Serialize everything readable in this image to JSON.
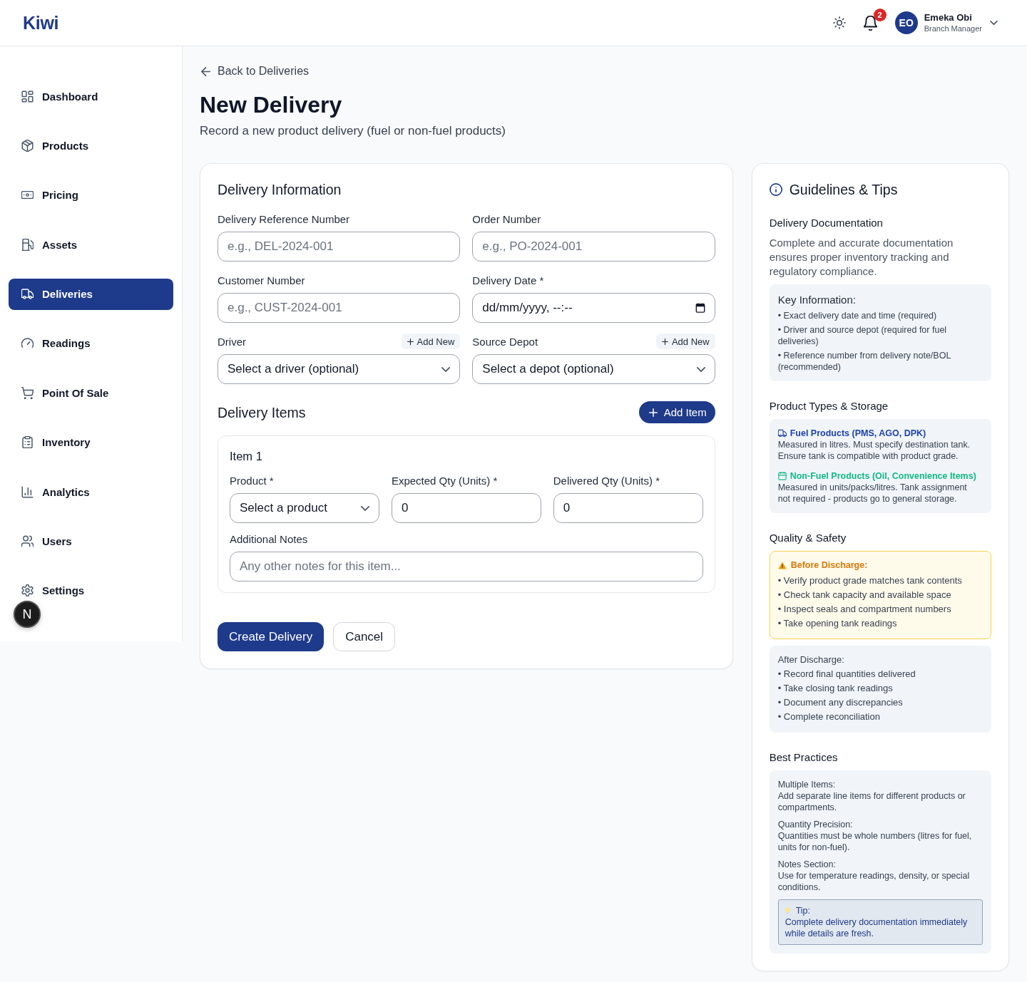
{
  "header": {
    "logo": "Kiwi",
    "notifications": "2",
    "user": {
      "initials": "EO",
      "name": "Emeka Obi",
      "role": "Branch Manager"
    }
  },
  "sidebar": {
    "items": [
      {
        "label": "Dashboard",
        "selected": false
      },
      {
        "label": "Products",
        "selected": false
      },
      {
        "label": "Pricing",
        "selected": false
      },
      {
        "label": "Assets",
        "selected": false
      },
      {
        "label": "Deliveries",
        "selected": true
      },
      {
        "label": "Readings",
        "selected": false
      },
      {
        "label": "Point Of Sale",
        "selected": false
      },
      {
        "label": "Inventory",
        "selected": false
      },
      {
        "label": "Analytics",
        "selected": false
      },
      {
        "label": "Users",
        "selected": false
      },
      {
        "label": "Settings",
        "selected": false
      }
    ]
  },
  "dev_indicator": {
    "label": "N"
  },
  "page": {
    "back_link": "Back to Deliveries",
    "title": "New Delivery",
    "subtitle": "Record a new product delivery (fuel or non-fuel products)"
  },
  "form": {
    "title": "Delivery Information",
    "fields": [
      {
        "kind": "text",
        "label": "Delivery Reference Number",
        "placeholder": "e.g., DEL-2024-001"
      },
      {
        "kind": "text",
        "label": "Order Number",
        "placeholder": "e.g., PO-2024-001"
      },
      {
        "kind": "text",
        "label": "Customer Number",
        "placeholder": "e.g., CUST-2024-001"
      },
      {
        "kind": "datetime",
        "label": "Delivery Date *",
        "value": "dd/mm/yyyy, --:--"
      },
      {
        "kind": "select",
        "label": "Driver",
        "value": "Select a driver (optional)",
        "action": "Add New"
      },
      {
        "kind": "select",
        "label": "Source Depot",
        "value": "Select a depot (optional)",
        "action": "Add New"
      }
    ],
    "items_section": {
      "title": "Delivery Items",
      "add_button": "Add Item",
      "items": [
        {
          "title": "Item 1",
          "fields": [
            {
              "kind": "select",
              "label": "Product *",
              "value": "Select a product"
            },
            {
              "kind": "number",
              "label": "Expected Qty (Units) *",
              "value": "0"
            },
            {
              "kind": "number",
              "label": "Delivered Qty (Units) *",
              "value": "0"
            }
          ],
          "notes": {
            "label": "Additional Notes",
            "placeholder": "Any other notes for this item..."
          }
        }
      ]
    },
    "actions": [
      {
        "kind": "primary",
        "label": "Create Delivery"
      },
      {
        "kind": "secondary",
        "label": "Cancel"
      }
    ]
  },
  "guidelines": {
    "title": "Guidelines & Tips",
    "sections": [
      {
        "heading": "Delivery Documentation",
        "text": "Complete and accurate documentation ensures proper inventory tracking and regulatory compliance.",
        "boxes": [
          {
            "kind": "info",
            "title": "Key Information:",
            "bullets": [
              "• Exact delivery date and time (required)",
              "• Driver and source depot (required for fuel deliveries)",
              "• Reference number from delivery note/BOL (recommended)"
            ]
          }
        ]
      },
      {
        "heading": "Product Types & Storage",
        "boxes": [
          {
            "kind": "types",
            "entries": [
              {
                "title": "Fuel Products (PMS, AGO, DPK)",
                "text": "Measured in litres. Must specify destination tank. Ensure tank is compatible with product grade.",
                "color": "#1e40af"
              },
              {
                "title": "Non-Fuel Products (Oil, Convenience Items)",
                "text": "Measured in units/packs/litres. Tank assignment not required - products go to general storage.",
                "color": "#10b981"
              }
            ]
          }
        ]
      },
      {
        "heading": "Quality & Safety",
        "boxes": [
          {
            "kind": "warning",
            "title": "Before Discharge:",
            "bullets": [
              "• Verify product grade matches tank contents",
              "• Check tank capacity and available space",
              "• Inspect seals and compartment numbers",
              "• Take opening tank readings"
            ]
          },
          {
            "kind": "plain",
            "title": "After Discharge:",
            "bullets": [
              "• Record final quantities delivered",
              "• Take closing tank readings",
              "• Document any discrepancies",
              "• Complete reconciliation"
            ]
          }
        ]
      },
      {
        "heading": "Best Practices",
        "boxes": [
          {
            "kind": "notes",
            "entries": [
              {
                "title": "Multiple Items:",
                "text": "Add separate line items for different products or compartments."
              },
              {
                "title": "Quantity Precision:",
                "text": "Quantities must be whole numbers (litres for fuel, units for non-fuel)."
              },
              {
                "title": "Notes Section:",
                "text": "Use for temperature readings, density, or special conditions."
              }
            ],
            "tip": {
              "title": "Tip:",
              "text": "Complete delivery documentation immediately while details are fresh."
            }
          }
        ]
      }
    ]
  }
}
